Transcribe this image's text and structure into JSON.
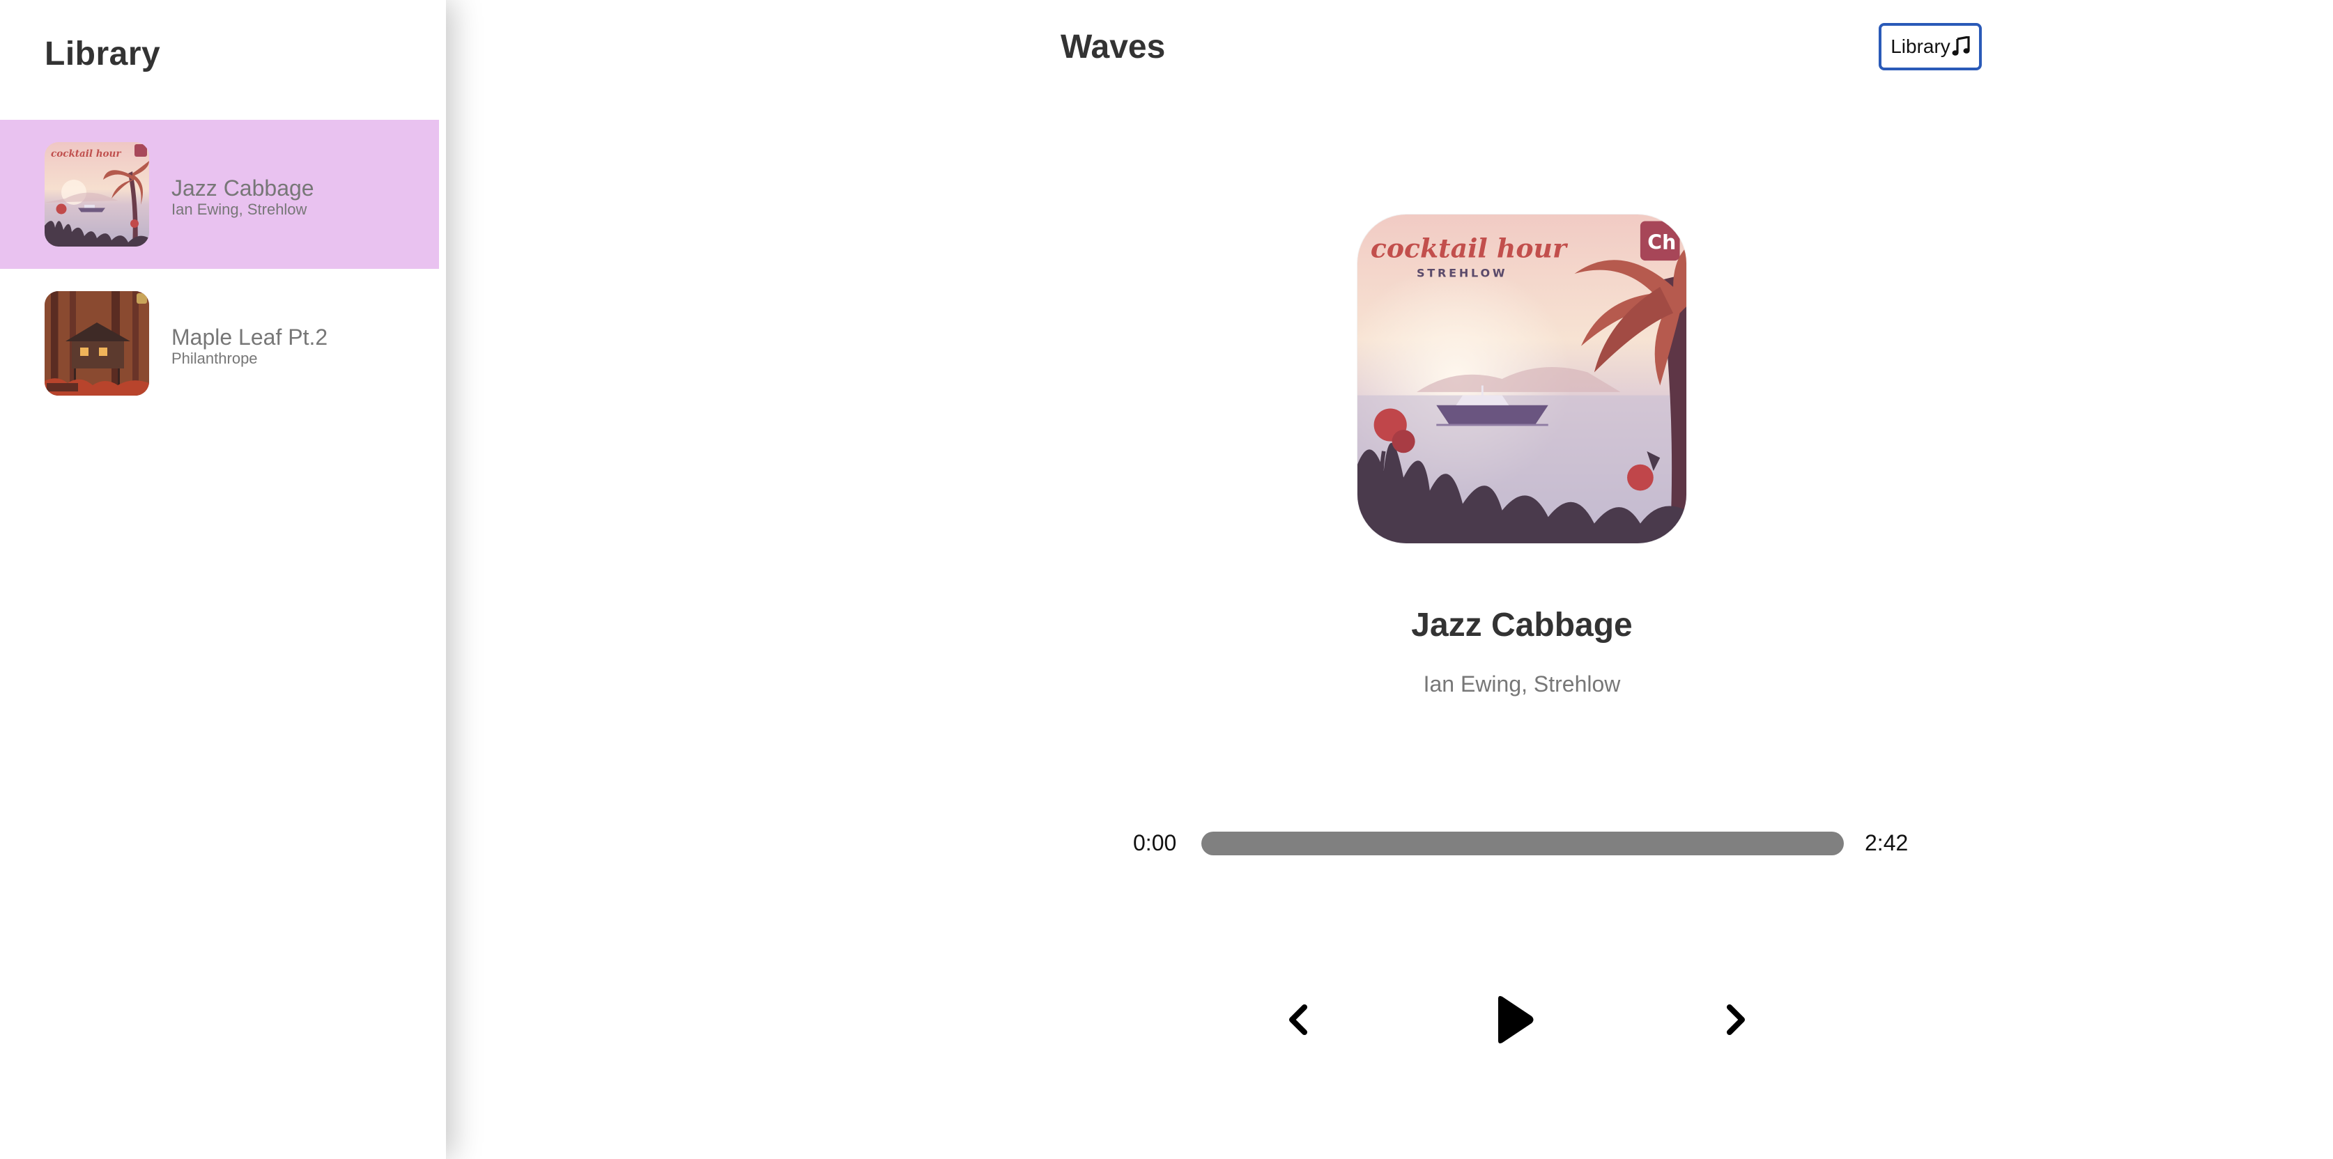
{
  "sidebar": {
    "title": "Library",
    "songs": [
      {
        "name": "Jazz Cabbage",
        "artist": "Ian Ewing, Strehlow",
        "active": true,
        "cover_icon": "album-cover-cocktail-hour"
      },
      {
        "name": "Maple Leaf Pt.2",
        "artist": "Philanthrope",
        "active": false,
        "cover_icon": "album-cover-maple-leaf"
      }
    ]
  },
  "header": {
    "title": "Waves",
    "library_button_label": "Library",
    "library_button_icon": "music-note-icon"
  },
  "player": {
    "cover_icon": "album-cover-cocktail-hour",
    "song_name": "Jazz Cabbage",
    "artist": "Ian Ewing, Strehlow",
    "current_time": "0:00",
    "total_time": "2:42",
    "progress_fraction": 0,
    "controls": {
      "prev_icon": "chevron-left-icon",
      "play_icon": "play-icon",
      "next_icon": "chevron-right-icon"
    }
  },
  "colors": {
    "active_song_bg": "#e9c2f0",
    "progress_track": "#808080",
    "library_button_border": "#2a5ab8",
    "heading_text": "#333333",
    "secondary_text": "#777777"
  }
}
